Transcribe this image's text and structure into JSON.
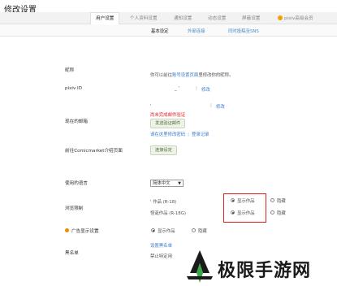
{
  "page": {
    "title": "修改设置"
  },
  "tabs": [
    {
      "label": "用户设置",
      "active": true
    },
    {
      "label": "个人资料设置"
    },
    {
      "label": "通知设置"
    },
    {
      "label": "动态设置"
    },
    {
      "label": "屏蔽设置"
    },
    {
      "label": "pixiv高级会员"
    }
  ],
  "subtabs": [
    {
      "label": "基本设定",
      "active": true
    },
    {
      "label": "外部连接"
    },
    {
      "label": "同时投稿至SNS"
    }
  ],
  "nickname": {
    "label": "昵称",
    "desc_pre": "你可以前往",
    "desc_link": "账号设置页面",
    "desc_post": "里修改你的昵称。"
  },
  "pixiv_id": {
    "label": "pixiv ID",
    "value": "_ '",
    "edit": "修改"
  },
  "email": {
    "label": "现在的邮箱",
    "value": "' ",
    "edit": "修改",
    "unverified": "尚未完成邮件验证",
    "send_button": "发送验证邮件",
    "change_pre": "请在这里修改密码",
    "login_history": "登录记录"
  },
  "comicmarket": {
    "label": "前往Comicmarket介绍页面",
    "button": "连接设定"
  },
  "language": {
    "label": "使用的语言",
    "value": "简体中文"
  },
  "browse_limit": {
    "label": "浏览限制",
    "row1_text": "' 作品 (R-18)",
    "row2_text": "怪诞作品 (R-18G)",
    "show": "显示作品",
    "hide": "隐藏"
  },
  "ads": {
    "label": "广告显示设置",
    "show": "显示作品",
    "hide": "隐藏"
  },
  "blacklist": {
    "label": "黑名单",
    "link": "设置黑名单",
    "note": "禁止特定用"
  },
  "watermark": {
    "text": "极限手游网"
  },
  "colors": {
    "accent_red": "#e02020",
    "link_blue": "#3a7bc8",
    "pixiv_orange": "#f2a100"
  }
}
